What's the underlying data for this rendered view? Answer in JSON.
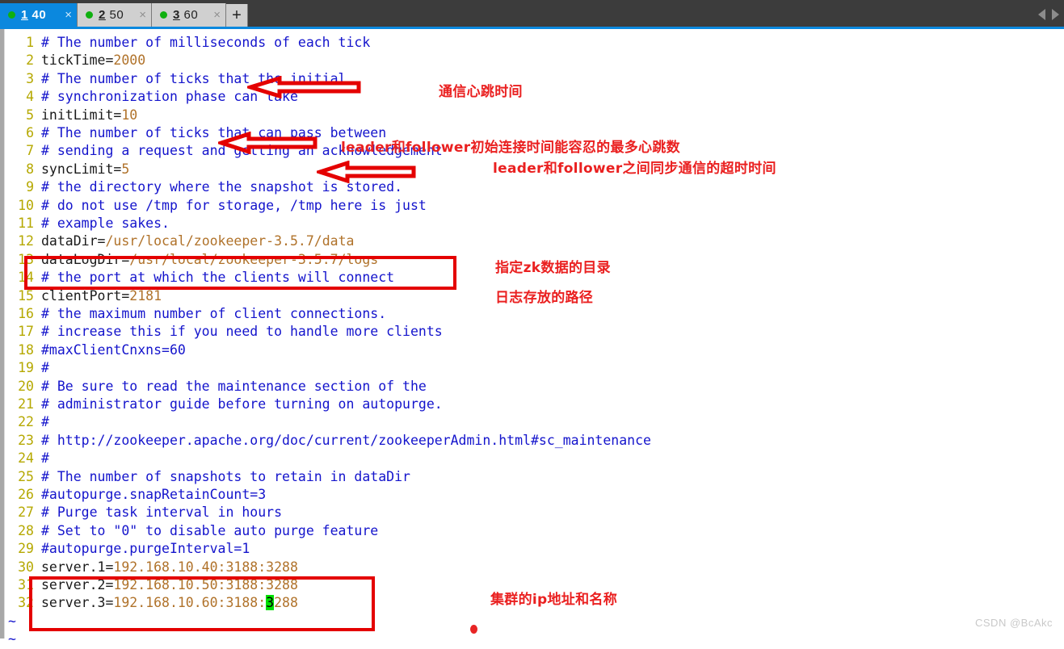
{
  "window": {
    "tabs": [
      {
        "accel": "1",
        "label": "40",
        "active": true,
        "dot_color": "#10b010",
        "close_label": "×"
      },
      {
        "accel": "2",
        "label": "50",
        "active": false,
        "dot_color": "#10b010",
        "close_label": "×"
      },
      {
        "accel": "3",
        "label": "60",
        "active": false,
        "dot_color": "#10b010",
        "close_label": "×"
      }
    ],
    "new_tab_label": "+",
    "active_tab_color": "#0b88de",
    "inactive_tab_color": "#d0d0d0",
    "titlebar_color": "#3c3c3c"
  },
  "editor": {
    "lines": [
      {
        "n": "1",
        "segments": [
          {
            "t": "# The number of milliseconds of each tick",
            "c": "cm"
          }
        ]
      },
      {
        "n": "2",
        "segments": [
          {
            "t": "tickTime=",
            "c": "key"
          },
          {
            "t": "2000",
            "c": "val"
          }
        ]
      },
      {
        "n": "3",
        "segments": [
          {
            "t": "# The number of ticks that the initial",
            "c": "cm"
          }
        ]
      },
      {
        "n": "4",
        "segments": [
          {
            "t": "# synchronization phase can take",
            "c": "cm"
          }
        ]
      },
      {
        "n": "5",
        "segments": [
          {
            "t": "initLimit=",
            "c": "key"
          },
          {
            "t": "10",
            "c": "val"
          }
        ]
      },
      {
        "n": "6",
        "segments": [
          {
            "t": "# The number of ticks that can pass between",
            "c": "cm"
          }
        ]
      },
      {
        "n": "7",
        "segments": [
          {
            "t": "# sending a request and getting an acknowledgement",
            "c": "cm"
          }
        ]
      },
      {
        "n": "8",
        "segments": [
          {
            "t": "syncLimit=",
            "c": "key"
          },
          {
            "t": "5",
            "c": "val"
          }
        ]
      },
      {
        "n": "9",
        "segments": [
          {
            "t": "# the directory where the snapshot is stored.",
            "c": "cm"
          }
        ]
      },
      {
        "n": "10",
        "segments": [
          {
            "t": "# do not use /tmp for storage, /tmp here is just",
            "c": "cm"
          }
        ]
      },
      {
        "n": "11",
        "segments": [
          {
            "t": "# example sakes.",
            "c": "cm"
          }
        ]
      },
      {
        "n": "12",
        "segments": [
          {
            "t": "dataDir=",
            "c": "key"
          },
          {
            "t": "/usr/local/zookeeper-3.5.7/data",
            "c": "val"
          }
        ]
      },
      {
        "n": "13",
        "segments": [
          {
            "t": "dataLogDir=",
            "c": "key"
          },
          {
            "t": "/usr/local/zookeeper-3.5.7/logs",
            "c": "val"
          }
        ]
      },
      {
        "n": "14",
        "segments": [
          {
            "t": "# the port at which the clients will connect",
            "c": "cm"
          }
        ]
      },
      {
        "n": "15",
        "segments": [
          {
            "t": "clientPort=",
            "c": "key"
          },
          {
            "t": "2181",
            "c": "val"
          }
        ]
      },
      {
        "n": "16",
        "segments": [
          {
            "t": "# the maximum number of client connections.",
            "c": "cm"
          }
        ]
      },
      {
        "n": "17",
        "segments": [
          {
            "t": "# increase this if you need to handle more clients",
            "c": "cm"
          }
        ]
      },
      {
        "n": "18",
        "segments": [
          {
            "t": "#maxClientCnxns=60",
            "c": "cm"
          }
        ]
      },
      {
        "n": "19",
        "segments": [
          {
            "t": "#",
            "c": "cm"
          }
        ]
      },
      {
        "n": "20",
        "segments": [
          {
            "t": "# Be sure to read the maintenance section of the",
            "c": "cm"
          }
        ]
      },
      {
        "n": "21",
        "segments": [
          {
            "t": "# administrator guide before turning on autopurge.",
            "c": "cm"
          }
        ]
      },
      {
        "n": "22",
        "segments": [
          {
            "t": "#",
            "c": "cm"
          }
        ]
      },
      {
        "n": "23",
        "segments": [
          {
            "t": "# http://zookeeper.apache.org/doc/current/zookeeperAdmin.html#sc_maintenance",
            "c": "cm"
          }
        ]
      },
      {
        "n": "24",
        "segments": [
          {
            "t": "#",
            "c": "cm"
          }
        ]
      },
      {
        "n": "25",
        "segments": [
          {
            "t": "# The number of snapshots to retain in dataDir",
            "c": "cm"
          }
        ]
      },
      {
        "n": "26",
        "segments": [
          {
            "t": "#autopurge.snapRetainCount=3",
            "c": "cm"
          }
        ]
      },
      {
        "n": "27",
        "segments": [
          {
            "t": "# Purge task interval in hours",
            "c": "cm"
          }
        ]
      },
      {
        "n": "28",
        "segments": [
          {
            "t": "# Set to \"0\" to disable auto purge feature",
            "c": "cm"
          }
        ]
      },
      {
        "n": "29",
        "segments": [
          {
            "t": "#autopurge.purgeInterval=1",
            "c": "cm"
          }
        ]
      },
      {
        "n": "30",
        "segments": [
          {
            "t": "server.1=",
            "c": "key"
          },
          {
            "t": "192.168.10.40:3188:3288",
            "c": "val"
          }
        ]
      },
      {
        "n": "31",
        "segments": [
          {
            "t": "server.2=",
            "c": "key"
          },
          {
            "t": "192.168.10.50:3188:3288",
            "c": "val"
          }
        ]
      },
      {
        "n": "32",
        "segments": [
          {
            "t": "server.3=",
            "c": "key"
          },
          {
            "t": "192.168.10.60:3188:",
            "c": "val"
          },
          {
            "t": "3",
            "c": "cursor"
          },
          {
            "t": "288",
            "c": "val"
          }
        ]
      }
    ],
    "empty_markers": [
      "~",
      "~"
    ],
    "colors": {
      "line_number": "#b5a800",
      "comment": "#1414cc",
      "key": "#1a1a1a",
      "value": "#b0722a",
      "cursor_highlight": "#00e000"
    }
  },
  "annotations": {
    "color": "#ea2020",
    "notes": [
      {
        "id": "tickTime",
        "text": "通信心跳时间"
      },
      {
        "id": "initLimit",
        "text": "leader和follower初始连接时间能容忍的最多心跳数"
      },
      {
        "id": "syncLimit",
        "text": "leader和follower之间同步通信的超时时间"
      },
      {
        "id": "dataDir",
        "text": "指定zk数据的目录"
      },
      {
        "id": "dataLogDir",
        "text": "日志存放的路径"
      },
      {
        "id": "servers",
        "text": "集群的ip地址和名称"
      }
    ]
  },
  "watermark": {
    "text": "CSDN @BcAkc"
  }
}
